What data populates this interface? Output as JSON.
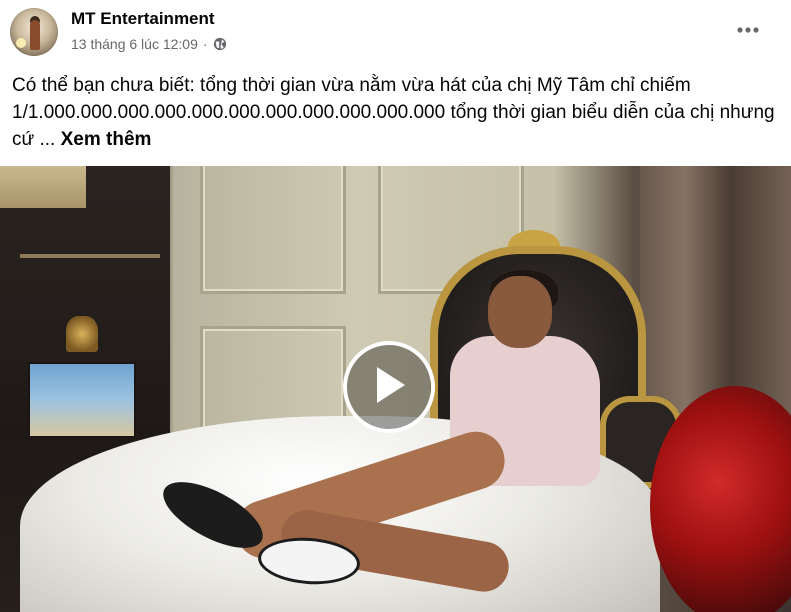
{
  "post": {
    "author": "MT Entertainment",
    "timestamp": "13 tháng 6 lúc 12:09",
    "separator": "·",
    "privacy_icon": "globe-icon",
    "more_icon": "more-horizontal-icon",
    "caption": {
      "text": "Có thể bạn chưa biết: tổng thời gian vừa nằm vừa hát của chị Mỹ Tâm chỉ chiếm 1/1.000.000.000.000.000.000.000.000.000.000.000 tổng thời gian biểu diễn của chị nhưng cứ ...",
      "see_more": "Xem thêm"
    },
    "video": {
      "play_icon": "play-icon"
    }
  },
  "colors": {
    "text_primary": "#050505",
    "text_secondary": "#65676b",
    "background": "#ffffff"
  }
}
